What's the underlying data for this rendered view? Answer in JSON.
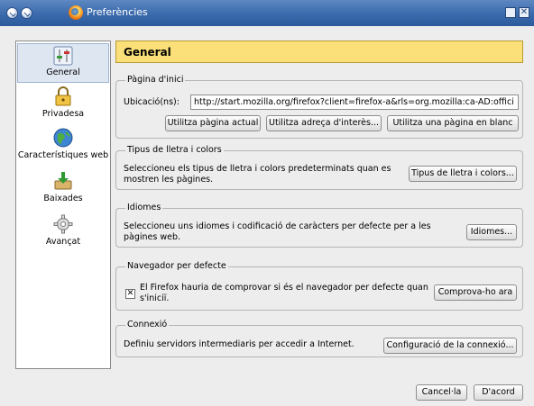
{
  "window": {
    "title": "Preferències",
    "colors": {
      "titlebar": "#3a6aac",
      "header": "#fbe07a",
      "selected": "#dde6f1"
    }
  },
  "sidebar": {
    "items": [
      {
        "label": "General",
        "icon": "general-settings-icon",
        "selected": true
      },
      {
        "label": "Privadesa",
        "icon": "padlock-icon",
        "selected": false
      },
      {
        "label": "Característiques web",
        "icon": "globe-icon",
        "selected": false
      },
      {
        "label": "Baixades",
        "icon": "download-icon",
        "selected": false
      },
      {
        "label": "Avançat",
        "icon": "gear-icon",
        "selected": false
      }
    ]
  },
  "main": {
    "title": "General",
    "homepage": {
      "legend": "Pàgina d'inici",
      "location_label": "Ubicació(ns):",
      "location_value": "http://start.mozilla.org/firefox?client=firefox-a&rls=org.mozilla:ca-AD:offici",
      "use_current": "Utilitza pàgina actual",
      "use_bookmark": "Utilitza adreça d'interès...",
      "use_blank": "Utilitza una pàgina en blanc"
    },
    "fonts": {
      "legend": "Tipus de lletra i colors",
      "description": "Seleccioneu els tipus de lletra i colors predeterminats quan es mostren les pàgines.",
      "button": "Tipus de lletra i colors..."
    },
    "languages": {
      "legend": "Idiomes",
      "description": "Seleccioneu uns idiomes i codificació de caràcters per defecte per a les pàgines web.",
      "button": "Idiomes..."
    },
    "default_browser": {
      "legend": "Navegador per defecte",
      "checkbox_label": "El Firefox hauria de comprovar si és el navegador per defecte quan s'iniciï.",
      "checked": true,
      "button": "Comprova-ho ara"
    },
    "connection": {
      "legend": "Connexió",
      "description": "Definiu servidors intermediaris per accedir a Internet.",
      "button": "Configuració de la connexió..."
    }
  },
  "footer": {
    "cancel": "Cancel·la",
    "ok": "D'acord"
  }
}
